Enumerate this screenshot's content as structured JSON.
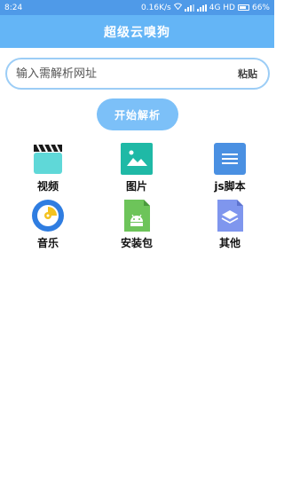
{
  "status": {
    "time": "8:24",
    "speed": "0.16K/s",
    "network": "4G HD",
    "battery": "66%"
  },
  "app": {
    "title": "超级云嗅狗"
  },
  "search": {
    "placeholder": "输入需解析网址",
    "value": "",
    "paste_label": "粘贴"
  },
  "actions": {
    "parse_label": "开始解析"
  },
  "categories": [
    {
      "label": "视频",
      "icon": "video-clapper-icon",
      "color": "#5fd8d8"
    },
    {
      "label": "图片",
      "icon": "image-icon",
      "color": "#1fb9a6"
    },
    {
      "label": "js脚本",
      "icon": "document-icon",
      "color": "#4a90e2"
    },
    {
      "label": "音乐",
      "icon": "music-disc-icon",
      "color": "#2f7de1"
    },
    {
      "label": "安装包",
      "icon": "android-package-icon",
      "color": "#6dc45a"
    },
    {
      "label": "其他",
      "icon": "layers-file-icon",
      "color": "#7f96ee"
    }
  ]
}
